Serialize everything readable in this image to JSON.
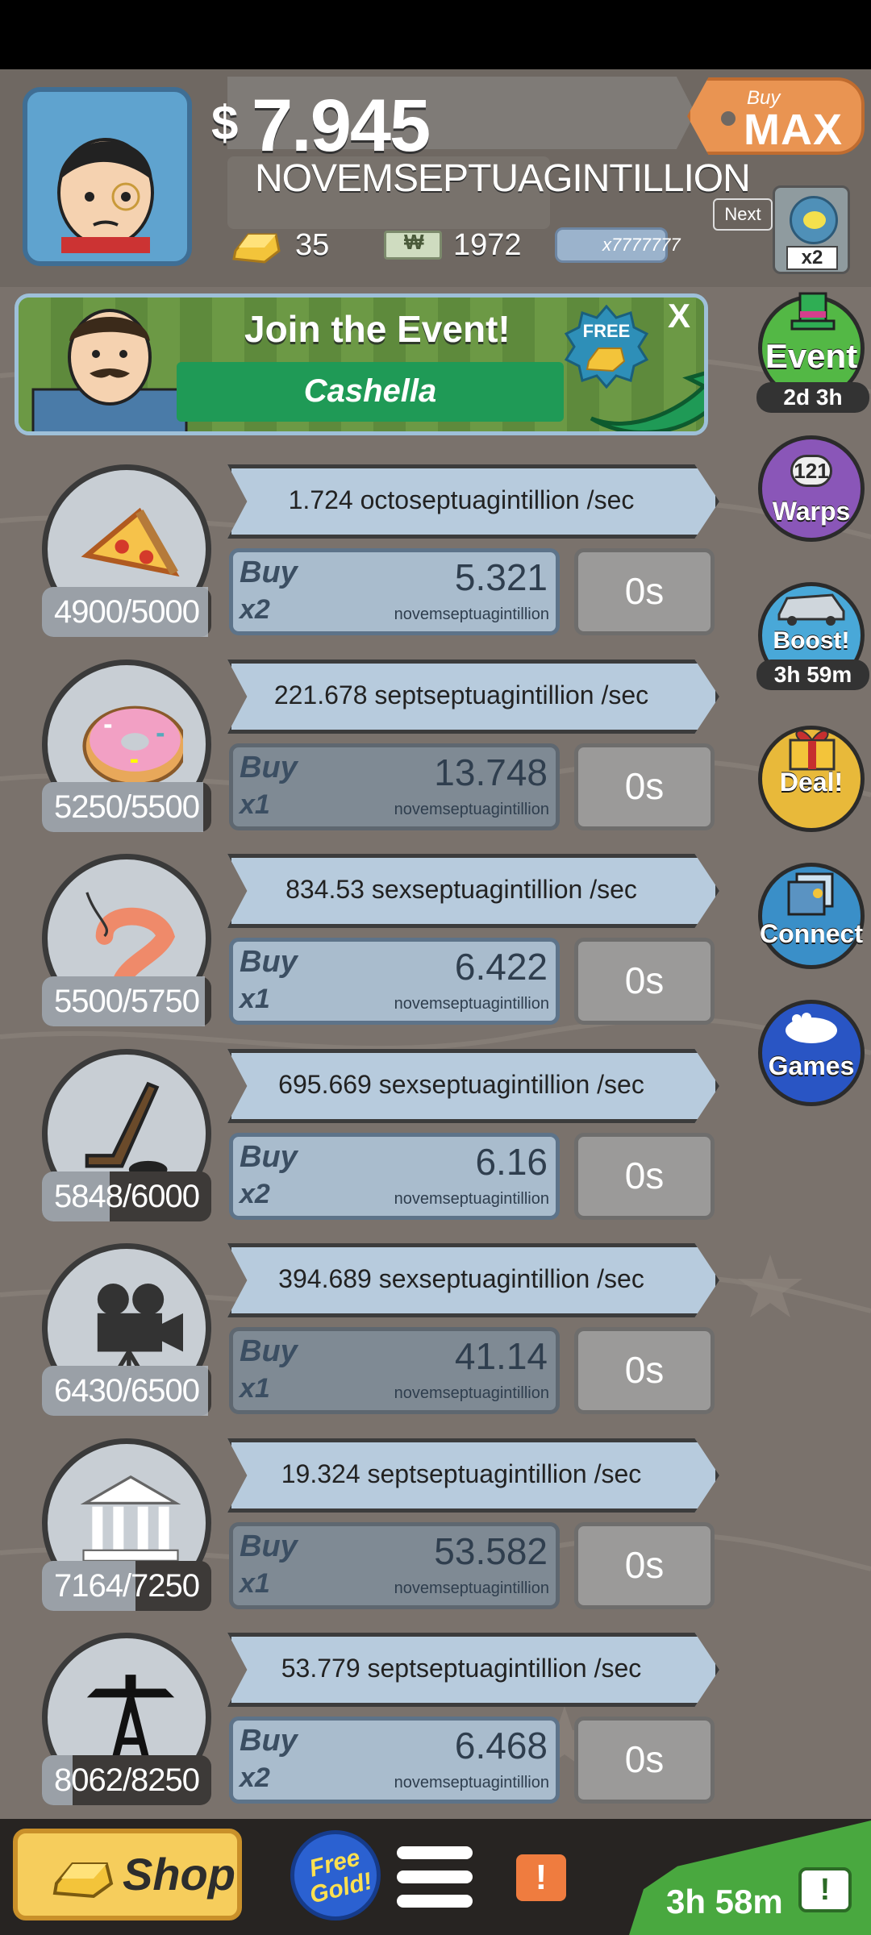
{
  "header": {
    "currency_symbol": "$",
    "money_value": "7.945",
    "money_unit": "NOVEMSEPTUAGINTILLION",
    "gold_count": "35",
    "mega_bucks": "1972",
    "mega_bills_label": "x7777777",
    "buy_max_small": "Buy",
    "buy_max_big": "MAX",
    "next_label": "Next",
    "next_multiplier": "x2"
  },
  "event_banner": {
    "title": "Join the Event!",
    "event_name": "Cashella",
    "free_label": "FREE",
    "close_label": "X"
  },
  "businesses": [
    {
      "icon": "pizza-icon",
      "count": "4900/5000",
      "progress": 0.98,
      "rate": "1.724 octoseptuagintillion /sec",
      "buy_label": "Buy",
      "buy_mult": "x2",
      "cost": "5.321",
      "cost_unit": "novemseptuagintillion",
      "timer": "0s",
      "affordable": true
    },
    {
      "icon": "donut-icon",
      "count": "5250/5500",
      "progress": 0.95,
      "rate": "221.678 septseptuagintillion /sec",
      "buy_label": "Buy",
      "buy_mult": "x1",
      "cost": "13.748",
      "cost_unit": "novemseptuagintillion",
      "timer": "0s",
      "affordable": false
    },
    {
      "icon": "shrimp-icon",
      "count": "5500/5750",
      "progress": 0.96,
      "rate": "834.53 sexseptuagintillion /sec",
      "buy_label": "Buy",
      "buy_mult": "x1",
      "cost": "6.422",
      "cost_unit": "novemseptuagintillion",
      "timer": "0s",
      "affordable": true
    },
    {
      "icon": "hockey-stick-icon",
      "count": "5848/6000",
      "progress": 0.4,
      "rate": "695.669 sexseptuagintillion /sec",
      "buy_label": "Buy",
      "buy_mult": "x2",
      "cost": "6.16",
      "cost_unit": "novemseptuagintillion",
      "timer": "0s",
      "affordable": true
    },
    {
      "icon": "movie-camera-icon",
      "count": "6430/6500",
      "progress": 0.98,
      "rate": "394.689 sexseptuagintillion /sec",
      "buy_label": "Buy",
      "buy_mult": "x1",
      "cost": "41.14",
      "cost_unit": "novemseptuagintillion",
      "timer": "0s",
      "affordable": false
    },
    {
      "icon": "bank-icon",
      "count": "7164/7250",
      "progress": 0.55,
      "rate": "19.324 septseptuagintillion /sec",
      "buy_label": "Buy",
      "buy_mult": "x1",
      "cost": "53.582",
      "cost_unit": "novemseptuagintillion",
      "timer": "0s",
      "affordable": false
    },
    {
      "icon": "oil-rig-icon",
      "count": "8062/8250",
      "progress": 0.18,
      "rate": "53.779 septseptuagintillion /sec",
      "buy_label": "Buy",
      "buy_mult": "x2",
      "cost": "6.468",
      "cost_unit": "novemseptuagintillion",
      "timer": "0s",
      "affordable": true
    }
  ],
  "side_buttons": {
    "event": {
      "label": "Event",
      "sub": "2d 3h"
    },
    "warps": {
      "label": "Warps",
      "count": "121"
    },
    "boost": {
      "label": "Boost!",
      "sub": "3h 59m"
    },
    "deal": {
      "label": "Deal!"
    },
    "connect": {
      "label": "Connect"
    },
    "games": {
      "label": "Games"
    }
  },
  "bottom": {
    "shop_label": "Shop",
    "free_gold_label": "Free Gold!",
    "alert_label": "!",
    "tv_timer": "3h 58m",
    "tv_label": "!"
  },
  "colors": {
    "background": "#7a726c",
    "event_green": "#1f9a56",
    "buy_enabled": "#a9bccd",
    "buy_disabled": "#7f8a94",
    "shop_yellow": "#f6cd5c"
  }
}
